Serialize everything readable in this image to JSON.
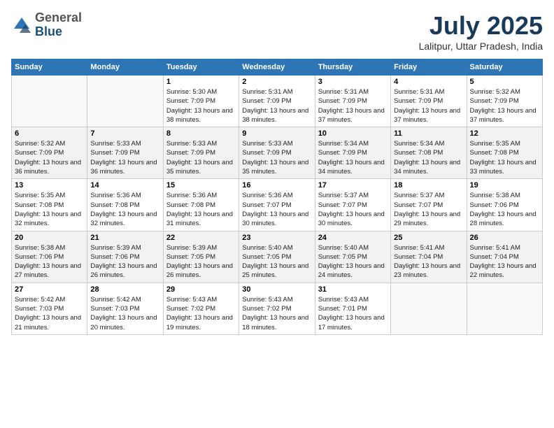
{
  "header": {
    "logo_general": "General",
    "logo_blue": "Blue",
    "month_title": "July 2025",
    "location": "Lalitpur, Uttar Pradesh, India"
  },
  "weekdays": [
    "Sunday",
    "Monday",
    "Tuesday",
    "Wednesday",
    "Thursday",
    "Friday",
    "Saturday"
  ],
  "weeks": [
    [
      {
        "day": "",
        "info": ""
      },
      {
        "day": "",
        "info": ""
      },
      {
        "day": "1",
        "info": "Sunrise: 5:30 AM\nSunset: 7:09 PM\nDaylight: 13 hours and 38 minutes."
      },
      {
        "day": "2",
        "info": "Sunrise: 5:31 AM\nSunset: 7:09 PM\nDaylight: 13 hours and 38 minutes."
      },
      {
        "day": "3",
        "info": "Sunrise: 5:31 AM\nSunset: 7:09 PM\nDaylight: 13 hours and 37 minutes."
      },
      {
        "day": "4",
        "info": "Sunrise: 5:31 AM\nSunset: 7:09 PM\nDaylight: 13 hours and 37 minutes."
      },
      {
        "day": "5",
        "info": "Sunrise: 5:32 AM\nSunset: 7:09 PM\nDaylight: 13 hours and 37 minutes."
      }
    ],
    [
      {
        "day": "6",
        "info": "Sunrise: 5:32 AM\nSunset: 7:09 PM\nDaylight: 13 hours and 36 minutes."
      },
      {
        "day": "7",
        "info": "Sunrise: 5:33 AM\nSunset: 7:09 PM\nDaylight: 13 hours and 36 minutes."
      },
      {
        "day": "8",
        "info": "Sunrise: 5:33 AM\nSunset: 7:09 PM\nDaylight: 13 hours and 35 minutes."
      },
      {
        "day": "9",
        "info": "Sunrise: 5:33 AM\nSunset: 7:09 PM\nDaylight: 13 hours and 35 minutes."
      },
      {
        "day": "10",
        "info": "Sunrise: 5:34 AM\nSunset: 7:09 PM\nDaylight: 13 hours and 34 minutes."
      },
      {
        "day": "11",
        "info": "Sunrise: 5:34 AM\nSunset: 7:08 PM\nDaylight: 13 hours and 34 minutes."
      },
      {
        "day": "12",
        "info": "Sunrise: 5:35 AM\nSunset: 7:08 PM\nDaylight: 13 hours and 33 minutes."
      }
    ],
    [
      {
        "day": "13",
        "info": "Sunrise: 5:35 AM\nSunset: 7:08 PM\nDaylight: 13 hours and 32 minutes."
      },
      {
        "day": "14",
        "info": "Sunrise: 5:36 AM\nSunset: 7:08 PM\nDaylight: 13 hours and 32 minutes."
      },
      {
        "day": "15",
        "info": "Sunrise: 5:36 AM\nSunset: 7:08 PM\nDaylight: 13 hours and 31 minutes."
      },
      {
        "day": "16",
        "info": "Sunrise: 5:36 AM\nSunset: 7:07 PM\nDaylight: 13 hours and 30 minutes."
      },
      {
        "day": "17",
        "info": "Sunrise: 5:37 AM\nSunset: 7:07 PM\nDaylight: 13 hours and 30 minutes."
      },
      {
        "day": "18",
        "info": "Sunrise: 5:37 AM\nSunset: 7:07 PM\nDaylight: 13 hours and 29 minutes."
      },
      {
        "day": "19",
        "info": "Sunrise: 5:38 AM\nSunset: 7:06 PM\nDaylight: 13 hours and 28 minutes."
      }
    ],
    [
      {
        "day": "20",
        "info": "Sunrise: 5:38 AM\nSunset: 7:06 PM\nDaylight: 13 hours and 27 minutes."
      },
      {
        "day": "21",
        "info": "Sunrise: 5:39 AM\nSunset: 7:06 PM\nDaylight: 13 hours and 26 minutes."
      },
      {
        "day": "22",
        "info": "Sunrise: 5:39 AM\nSunset: 7:05 PM\nDaylight: 13 hours and 26 minutes."
      },
      {
        "day": "23",
        "info": "Sunrise: 5:40 AM\nSunset: 7:05 PM\nDaylight: 13 hours and 25 minutes."
      },
      {
        "day": "24",
        "info": "Sunrise: 5:40 AM\nSunset: 7:05 PM\nDaylight: 13 hours and 24 minutes."
      },
      {
        "day": "25",
        "info": "Sunrise: 5:41 AM\nSunset: 7:04 PM\nDaylight: 13 hours and 23 minutes."
      },
      {
        "day": "26",
        "info": "Sunrise: 5:41 AM\nSunset: 7:04 PM\nDaylight: 13 hours and 22 minutes."
      }
    ],
    [
      {
        "day": "27",
        "info": "Sunrise: 5:42 AM\nSunset: 7:03 PM\nDaylight: 13 hours and 21 minutes."
      },
      {
        "day": "28",
        "info": "Sunrise: 5:42 AM\nSunset: 7:03 PM\nDaylight: 13 hours and 20 minutes."
      },
      {
        "day": "29",
        "info": "Sunrise: 5:43 AM\nSunset: 7:02 PM\nDaylight: 13 hours and 19 minutes."
      },
      {
        "day": "30",
        "info": "Sunrise: 5:43 AM\nSunset: 7:02 PM\nDaylight: 13 hours and 18 minutes."
      },
      {
        "day": "31",
        "info": "Sunrise: 5:43 AM\nSunset: 7:01 PM\nDaylight: 13 hours and 17 minutes."
      },
      {
        "day": "",
        "info": ""
      },
      {
        "day": "",
        "info": ""
      }
    ]
  ]
}
